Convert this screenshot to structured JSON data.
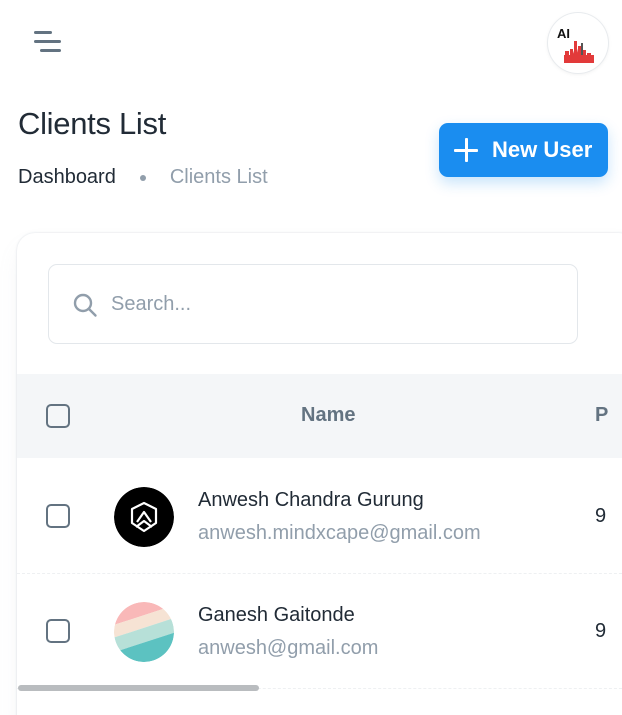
{
  "header": {
    "menu_icon": "menu-icon",
    "account": {
      "initials": "AI",
      "accent_color": "#e23a3a"
    }
  },
  "page": {
    "title": "Clients List",
    "breadcrumb": {
      "home": "Dashboard",
      "current": "Clients List"
    },
    "new_user_button": {
      "label": "New User",
      "icon": "plus-icon",
      "color": "#1a8df0"
    }
  },
  "table": {
    "search": {
      "placeholder": "Search...",
      "value": "",
      "icon": "search-icon"
    },
    "columns": {
      "name": "Name",
      "next_partial": "P"
    },
    "rows": [
      {
        "name": "Anwesh Chandra Gurung",
        "email": "anwesh.mindxcape@gmail.com",
        "next_partial": "9",
        "checked": false,
        "avatar": "mindxcape-logo-avatar"
      },
      {
        "name": "Ganesh Gaitonde",
        "email": "anwesh@gmail.com",
        "next_partial": "9",
        "checked": false,
        "avatar": "striped-pastel-avatar"
      }
    ]
  }
}
